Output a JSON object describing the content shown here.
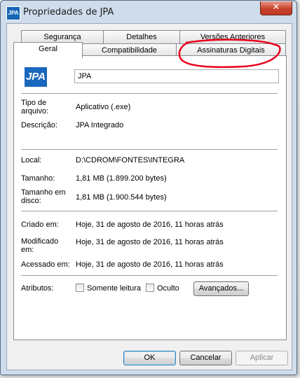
{
  "window": {
    "title": "Propriedades de JPA",
    "close_glyph": "✕"
  },
  "app_icon_text": "JPA",
  "tabs_row1": [
    "Segurança",
    "Detalhes",
    "Versões Anteriores"
  ],
  "tabs_row2": [
    "Geral",
    "Compatibilidade",
    "Assinaturas Digitais"
  ],
  "active_tab": "Geral",
  "general": {
    "file_name": "JPA",
    "file_type_label": "Tipo de arquivo:",
    "file_type_value": "Aplicativo (.exe)",
    "description_label": "Descrição:",
    "description_value": "JPA Integrado",
    "location_label": "Local:",
    "location_value": "D:\\CDROM\\FONTES\\INTEGRA",
    "size_label": "Tamanho:",
    "size_value": "1,81 MB (1.899.200 bytes)",
    "size_on_disk_label": "Tamanho em disco:",
    "size_on_disk_value": "1,81 MB (1.900.544 bytes)",
    "created_label": "Criado em:",
    "created_value": "Hoje, 31 de agosto de 2016, 11 horas atrás",
    "modified_label": "Modificado em:",
    "modified_value": "Hoje, 31 de agosto de 2016, 11 horas atrás",
    "accessed_label": "Acessado em:",
    "accessed_value": "Hoje, 31 de agosto de 2016, 11 horas atrás",
    "attributes_label": "Atributos:",
    "readonly_label": "Somente leitura",
    "readonly_checked": false,
    "hidden_label": "Oculto",
    "hidden_checked": false,
    "advanced_button": "Avançados..."
  },
  "buttons": {
    "ok": "OK",
    "cancel": "Cancelar",
    "apply": "Aplicar"
  },
  "annotation_color": "#e8001c",
  "logo_text": "JPA"
}
